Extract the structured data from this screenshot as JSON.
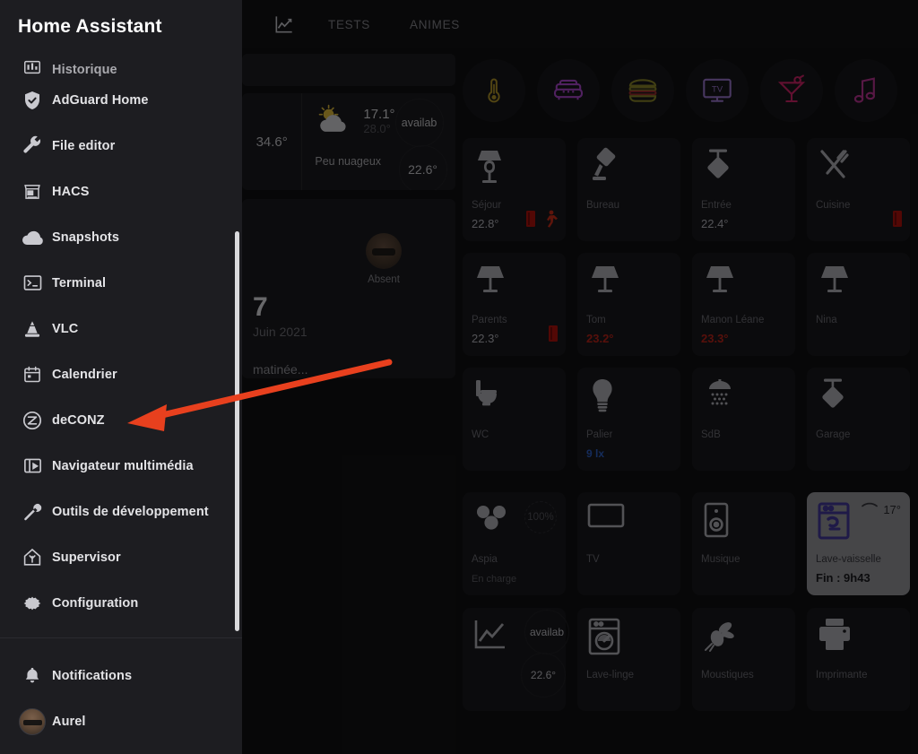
{
  "drawer": {
    "title": "Home Assistant",
    "items": [
      {
        "label": "Historique",
        "icon": "chart-bar-icon",
        "partial": true
      },
      {
        "label": "AdGuard Home",
        "icon": "shield-check-icon"
      },
      {
        "label": "File editor",
        "icon": "wrench-icon"
      },
      {
        "label": "HACS",
        "icon": "hacs-store-icon"
      },
      {
        "label": "Snapshots",
        "icon": "cloud-icon"
      },
      {
        "label": "Terminal",
        "icon": "terminal-icon"
      },
      {
        "label": "VLC",
        "icon": "vlc-cone-icon"
      },
      {
        "label": "Calendrier",
        "icon": "calendar-icon"
      },
      {
        "label": "deCONZ",
        "icon": "zigbee-icon"
      },
      {
        "label": "Navigateur multimédia",
        "icon": "media-player-icon"
      },
      {
        "label": "Outils de développement",
        "icon": "hammer-wrench-icon"
      },
      {
        "label": "Supervisor",
        "icon": "home-assistant-supervisor-icon"
      },
      {
        "label": "Configuration",
        "icon": "gear-icon"
      }
    ],
    "bottom_items": [
      {
        "label": "Notifications",
        "icon": "bell-icon"
      },
      {
        "label": "Aurel",
        "icon": "user-avatar"
      }
    ]
  },
  "topbar": {
    "tabs": [
      {
        "label": "",
        "icon": "chart-line-icon",
        "selected": true
      },
      {
        "label": "TESTS",
        "icon": ""
      },
      {
        "label": "ANIMES",
        "icon": ""
      }
    ]
  },
  "weather": {
    "left_value": "34.6°",
    "icon": "partly-cloudy-icon",
    "high": "17.1°",
    "low": "28.0°",
    "description": "Peu nuageux",
    "badge_top": "availab",
    "badge_bottom": "22.6°"
  },
  "person": {
    "label": "Absent",
    "avatar": "user-avatar"
  },
  "calendar": {
    "day": "7",
    "month_year": "Juin 2021",
    "event": "matinée..."
  },
  "scenes": [
    {
      "name": "thermometer-scene",
      "icon": "thermometer-icon",
      "color": "#b59a2a"
    },
    {
      "name": "sofa-scene",
      "icon": "sofa-icon",
      "color": "#b14bd4"
    },
    {
      "name": "burger-scene",
      "icon": "burger-icon",
      "color": "#8e8a2b"
    },
    {
      "name": "tv-scene",
      "icon": "tv-icon",
      "color": "#9f7ad6"
    },
    {
      "name": "cocktail-scene",
      "icon": "cocktail-icon",
      "color": "#d6246b"
    },
    {
      "name": "music-scene",
      "icon": "music-note-icon",
      "color": "#c3359a"
    }
  ],
  "cards": [
    {
      "name": "Séjour",
      "icon": "lamp-classic-icon",
      "value": "22.8°",
      "value_state": "normal",
      "badges": [
        "door-sensor-red",
        "motion-sensor-red"
      ]
    },
    {
      "name": "Bureau",
      "icon": "desk-lamp-icon",
      "value": "",
      "value_state": "none",
      "badges": []
    },
    {
      "name": "Entrée",
      "icon": "ceiling-lamp-icon",
      "value": "22.4°",
      "value_state": "normal",
      "badges": []
    },
    {
      "name": "Cuisine",
      "icon": "cutlery-icon",
      "value": "",
      "value_state": "none",
      "badges": [
        "door-sensor-red"
      ]
    },
    {
      "name": "Parents",
      "icon": "table-lamp-icon",
      "value": "22.3°",
      "value_state": "normal",
      "badges": [
        "door-sensor-red"
      ]
    },
    {
      "name": "Tom",
      "icon": "table-lamp-icon",
      "value": "23.2°",
      "value_state": "hot",
      "badges": []
    },
    {
      "name": "Manon Léane",
      "icon": "table-lamp-icon",
      "value": "23.3°",
      "value_state": "hot",
      "badges": []
    },
    {
      "name": "Nina",
      "icon": "table-lamp-icon",
      "value": "",
      "value_state": "none",
      "badges": []
    },
    {
      "name": "WC",
      "icon": "toilet-icon",
      "value": "",
      "value_state": "none",
      "badges": []
    },
    {
      "name": "Palier",
      "icon": "light-bulb-icon",
      "value": "9 lx",
      "value_state": "lux",
      "badges": []
    },
    {
      "name": "SdB",
      "icon": "shower-icon",
      "value": "",
      "value_state": "none",
      "badges": []
    },
    {
      "name": "Garage",
      "icon": "ceiling-lamp-icon",
      "value": "",
      "value_state": "none",
      "badges": []
    }
  ],
  "cards_row4": [
    {
      "name": "Aspia",
      "icon": "robot-vacuum-icon",
      "sub": "En charge",
      "top_right": "100%",
      "top_right_style": "ring",
      "active": false
    },
    {
      "name": "TV",
      "icon": "television-icon",
      "sub": "",
      "top_right": "",
      "top_right_style": "none",
      "active": false
    },
    {
      "name": "Musique",
      "icon": "speaker-icon",
      "sub": "",
      "top_right": "",
      "top_right_style": "none",
      "active": false
    },
    {
      "name": "Lave-vaisselle",
      "icon": "dishwasher-icon",
      "sub": "Fin : 9h43",
      "top_right": "17°",
      "top_right_style": "wifi",
      "active": true
    }
  ],
  "cards_row5": [
    {
      "name": "",
      "icon": "chart-line-icon",
      "sub": "",
      "badge_top": "availab",
      "badge_bottom": "22.6°"
    },
    {
      "name": "Lave-linge",
      "icon": "washing-machine-icon",
      "sub": "",
      "badge_top": "",
      "badge_bottom": ""
    },
    {
      "name": "Moustiques",
      "icon": "mosquito-icon",
      "sub": "",
      "badge_top": "",
      "badge_bottom": ""
    },
    {
      "name": "Imprimante",
      "icon": "printer-icon",
      "sub": "",
      "badge_top": "",
      "badge_bottom": ""
    }
  ],
  "annotation": {
    "type": "arrow",
    "color": "#e8401e",
    "points_to": "deCONZ"
  }
}
